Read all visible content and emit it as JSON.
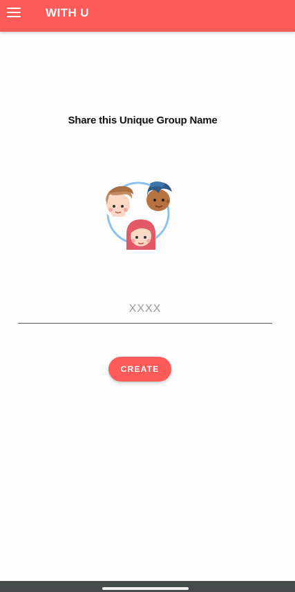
{
  "app_bar": {
    "title": "WITH U",
    "menu_icon": "hamburger-menu-icon",
    "color": "#fc5b5a"
  },
  "main": {
    "heading": "Share this Unique Group Name",
    "illustration_icon": "group-faces-icon",
    "group_input": {
      "value": "",
      "placeholder": "XXXX"
    },
    "create_button_label": "CREATE"
  },
  "system_nav": {
    "home_indicator": "home-indicator"
  }
}
